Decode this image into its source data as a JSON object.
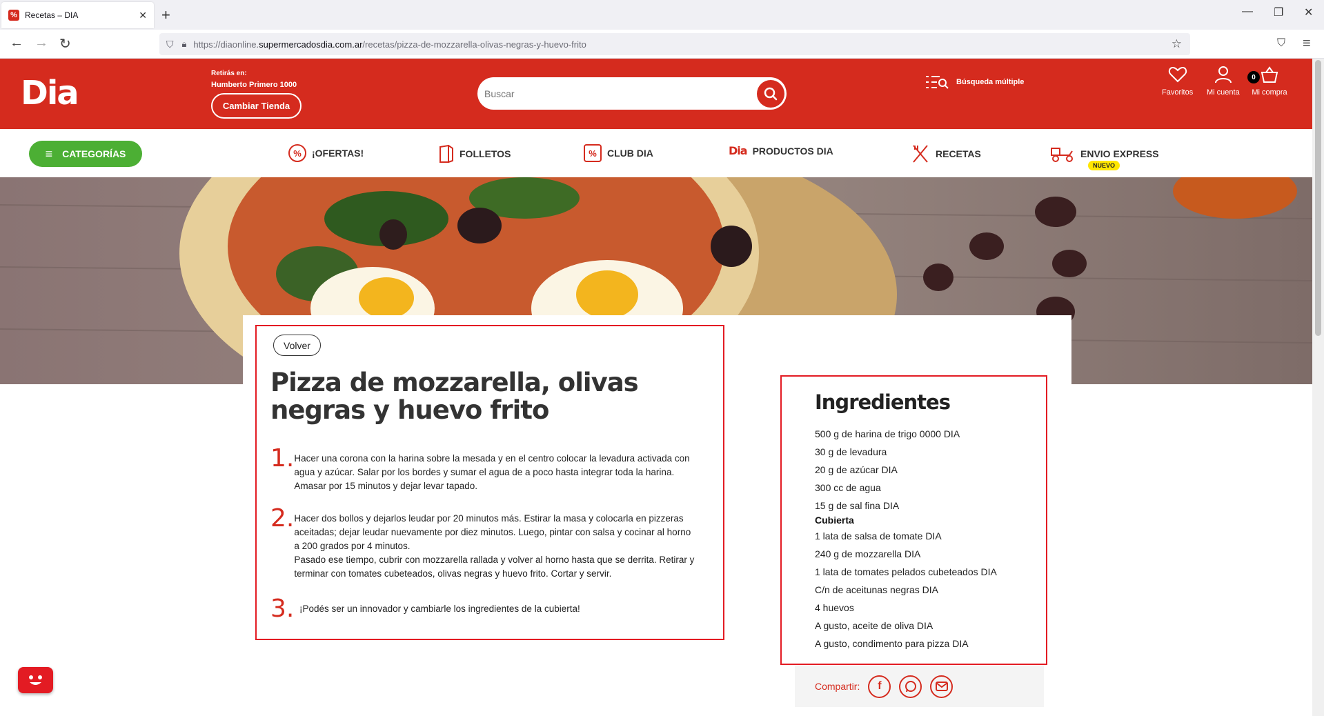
{
  "browser": {
    "tab_title": "Recetas – DIA",
    "url_prefix": "https://diaonline.",
    "url_domain": "supermercadosdia.com.ar",
    "url_path": "/recetas/pizza-de-mozzarella-olivas-negras-y-huevo-frito"
  },
  "header": {
    "logo": "Dia",
    "store_label": "Retirás en:",
    "store_name": "Humberto Primero 1000",
    "change_store": "Cambiar Tienda",
    "search_placeholder": "Buscar",
    "multi_search": "Búsqueda múltiple",
    "favorites": "Favoritos",
    "account": "Mi cuenta",
    "cart": "Mi compra",
    "cart_count": "0"
  },
  "nav": {
    "categories": "CATEGORÍAS",
    "offers": "¡OFERTAS!",
    "brochures": "FOLLETOS",
    "club": "CLUB DIA",
    "products_logo": "Dia",
    "products": "PRODUCTOS DIA",
    "recipes": "RECETAS",
    "express": "ENVIO EXPRESS",
    "express_badge": "NUEVO"
  },
  "recipe": {
    "back": "Volver",
    "title": "Pizza de mozzarella, olivas negras y huevo frito",
    "steps": [
      {
        "num": "1.",
        "text": "Hacer una corona con la harina sobre la mesada y en el centro colocar la levadura activada con agua y azúcar. Salar por los bordes y sumar el agua de a poco hasta integrar toda la harina. Amasar por 15 minutos y dejar levar tapado."
      },
      {
        "num": "2.",
        "text": "Hacer dos bollos y dejarlos leudar por 20 minutos más. Estirar la masa y colocarla en pizzeras aceitadas; dejar leudar nuevamente por diez minutos. Luego, pintar con salsa y cocinar al horno a 200 grados por 4 minutos.\nPasado ese tiempo, cubrir con mozzarella rallada y volver al horno hasta que se derrita. Retirar y terminar con tomates cubeteados, olivas negras y huevo frito. Cortar y servir."
      },
      {
        "num": "3.",
        "text": "¡Podés ser un innovador y cambiarle los ingredientes de la cubierta!"
      }
    ],
    "ingredients_title": "Ingredientes",
    "ingredients": [
      "500 g de harina de trigo 0000 DIA",
      "30 g de levadura",
      "20 g de azúcar DIA",
      "300 cc de agua",
      "15 g de sal fina DIA"
    ],
    "topping_title": "Cubierta",
    "topping": [
      "1 lata de salsa de tomate DIA",
      "240 g de mozzarella DIA",
      "1 lata de tomates pelados cubeteados DIA",
      "C/n de aceitunas negras DIA",
      "4 huevos",
      "A gusto, aceite de oliva DIA",
      "A gusto, condimento para pizza DIA"
    ],
    "share_label": "Compartir:"
  },
  "colors": {
    "brand_red": "#d52b1e",
    "highlight_red": "#e31b23",
    "category_green": "#4caf34",
    "badge_yellow": "#ffe600"
  }
}
